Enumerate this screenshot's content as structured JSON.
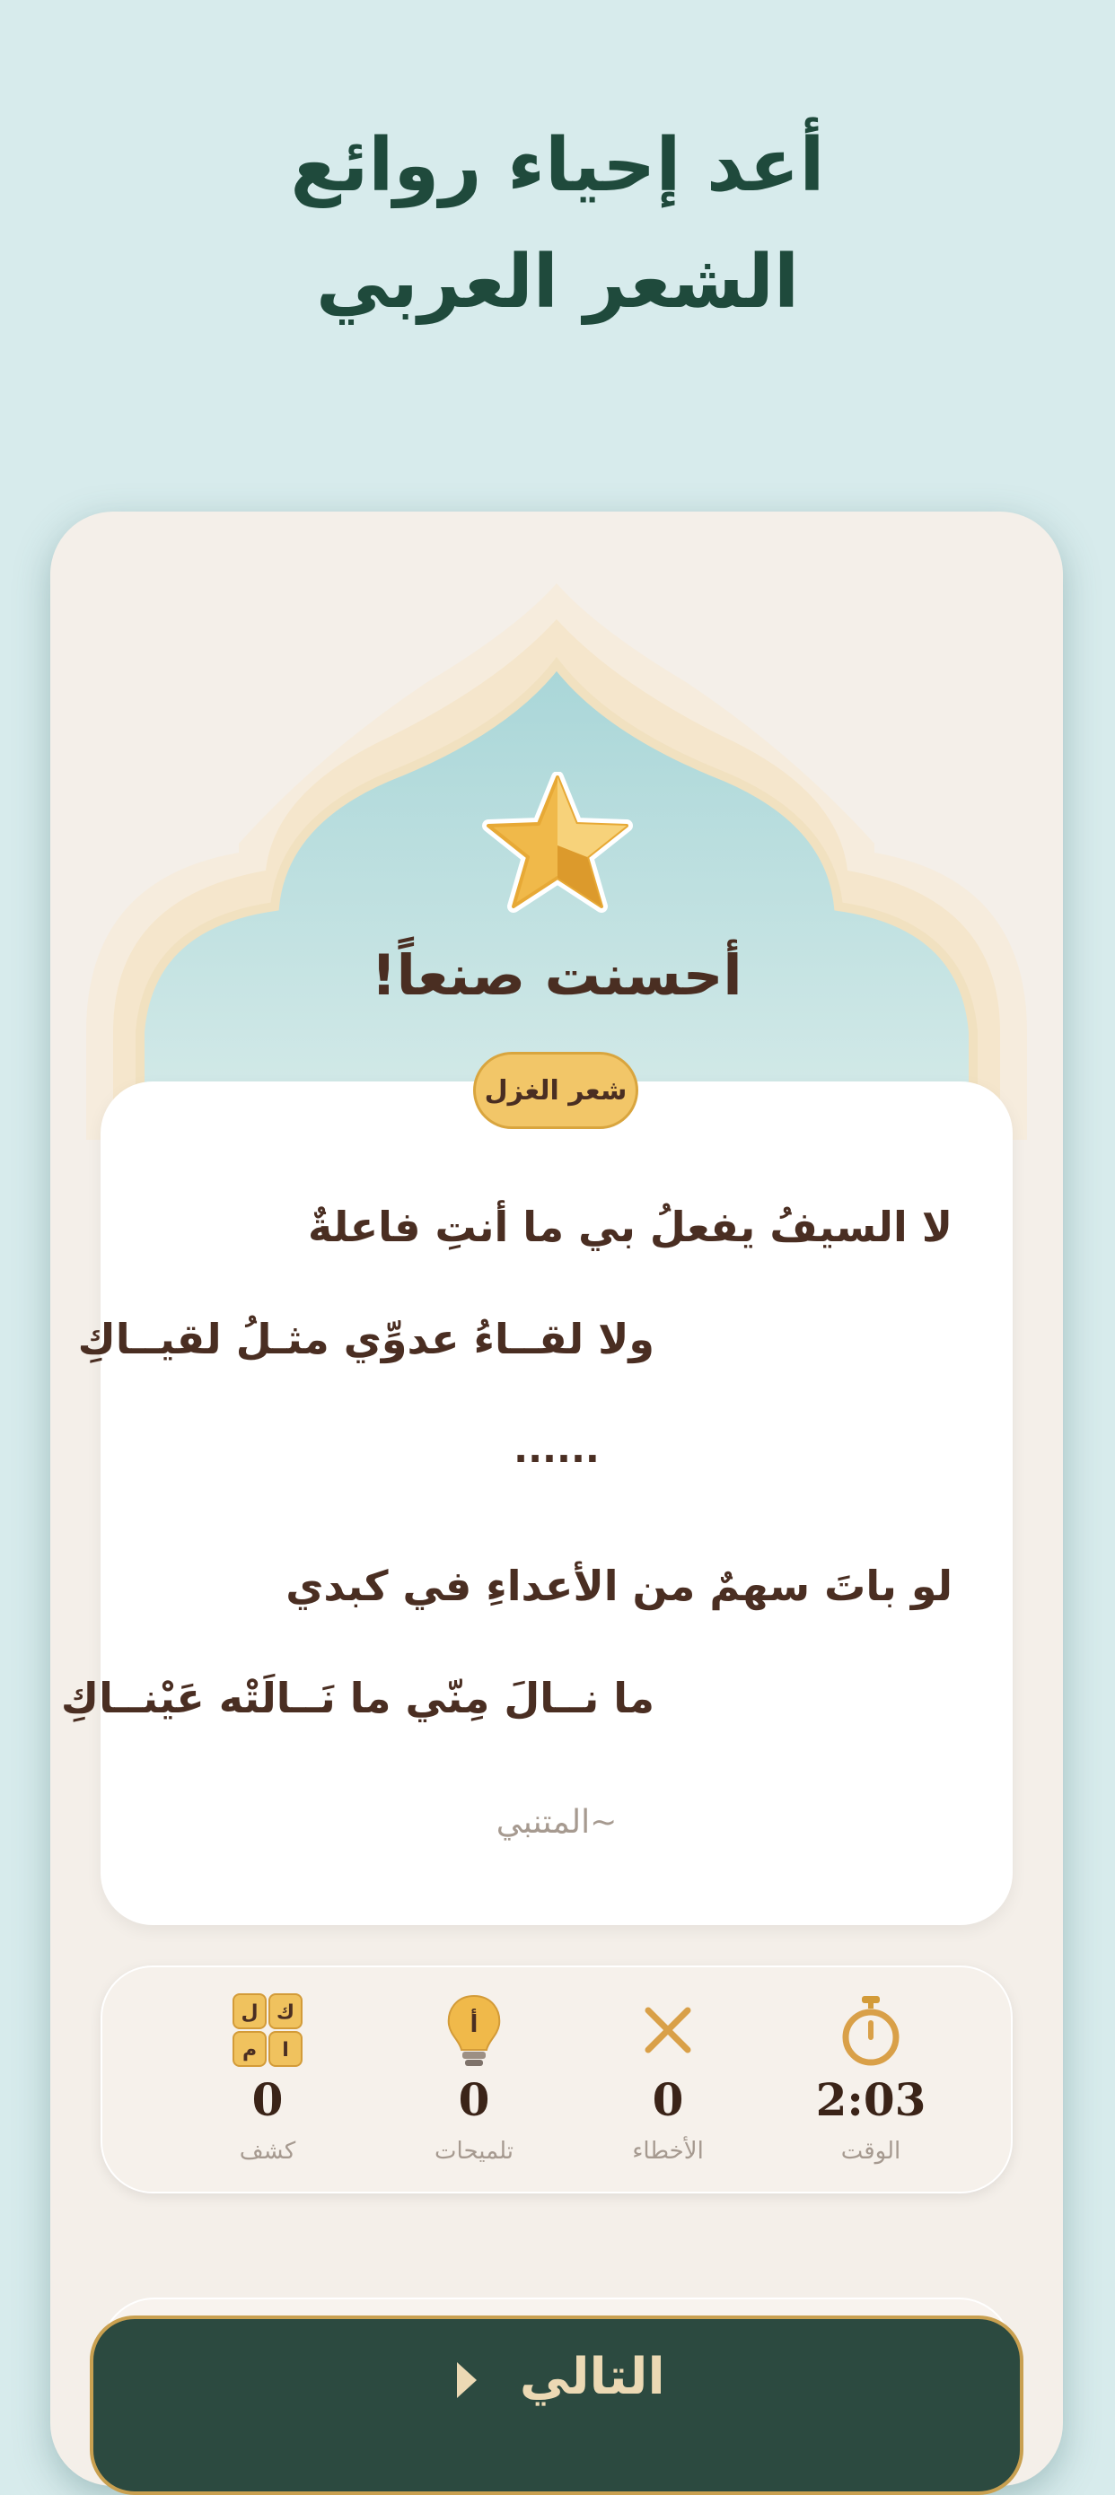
{
  "headline": {
    "line1": "أعد إحياء روائع",
    "line2": "الشعر العربي"
  },
  "result": {
    "star_icon": "star-icon",
    "title": "أحسنت صنعاً!"
  },
  "poem": {
    "category_badge": "شعر الغزل",
    "verses": [
      "لا السيفُ يفعلُ بي ما أنتِ فاعلةٌ",
      "ولا لقــاءُ عدوِّي مثـلُ لقيــاكِ",
      "......",
      "لو باتَ سهمٌ من الأعداءِ في كبدي",
      "ما نــالَ مِنّي ما نَــالَتْه عَيْنــاكِ"
    ],
    "poet": "~المتنبي"
  },
  "stats": {
    "time": {
      "value": "2:03",
      "label": "الوقت",
      "icon": "stopwatch-icon"
    },
    "mistakes": {
      "value": "0",
      "label": "الأخطاء",
      "icon": "close-x-icon"
    },
    "hints": {
      "value": "0",
      "label": "تلميحات",
      "icon": "lightbulb-icon"
    },
    "reveals": {
      "value": "0",
      "label": "كشف",
      "icon": "letter-tiles-icon",
      "tiles": [
        "ك",
        "ل",
        "ا",
        "م"
      ]
    }
  },
  "next_button": {
    "label": "التالي",
    "icon": "chevron-right-icon"
  },
  "colors": {
    "background": "#d7ebec",
    "headline": "#1f4a3c",
    "card": "#f4efe9",
    "gold": "#f2c668",
    "button": "#2c4a40",
    "text_dark": "#4a2e22"
  }
}
